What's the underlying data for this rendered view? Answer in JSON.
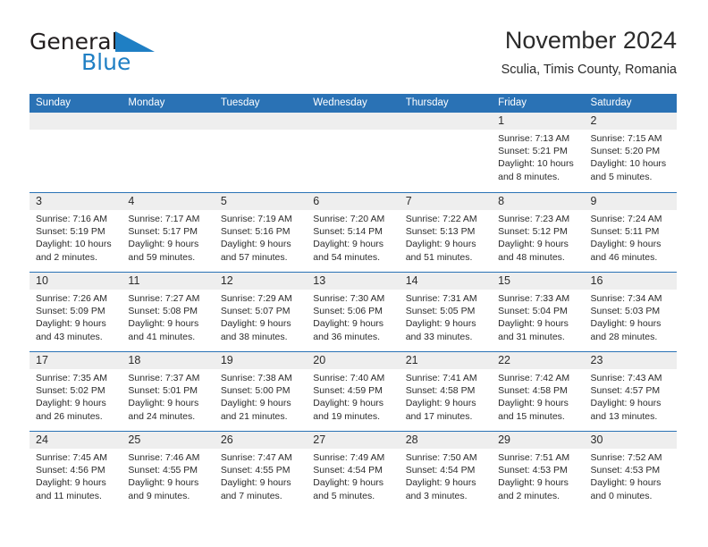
{
  "brand": {
    "name_part1": "General",
    "name_part2": "Blue",
    "accent_color": "#1f7fc4"
  },
  "header": {
    "title": "November 2024",
    "subtitle": "Sculia, Timis County, Romania"
  },
  "theme": {
    "header_blue": "#2a72b5",
    "day_band_gray": "#eeeeee",
    "text_color": "#2b2b2b"
  },
  "weekdays": [
    "Sunday",
    "Monday",
    "Tuesday",
    "Wednesday",
    "Thursday",
    "Friday",
    "Saturday"
  ],
  "weeks": [
    [
      {
        "day": "",
        "sunrise": "",
        "sunset": "",
        "daylight": "",
        "empty": true
      },
      {
        "day": "",
        "sunrise": "",
        "sunset": "",
        "daylight": "",
        "empty": true
      },
      {
        "day": "",
        "sunrise": "",
        "sunset": "",
        "daylight": "",
        "empty": true
      },
      {
        "day": "",
        "sunrise": "",
        "sunset": "",
        "daylight": "",
        "empty": true
      },
      {
        "day": "",
        "sunrise": "",
        "sunset": "",
        "daylight": "",
        "empty": true
      },
      {
        "day": "1",
        "sunrise": "Sunrise: 7:13 AM",
        "sunset": "Sunset: 5:21 PM",
        "daylight": "Daylight: 10 hours and 8 minutes."
      },
      {
        "day": "2",
        "sunrise": "Sunrise: 7:15 AM",
        "sunset": "Sunset: 5:20 PM",
        "daylight": "Daylight: 10 hours and 5 minutes."
      }
    ],
    [
      {
        "day": "3",
        "sunrise": "Sunrise: 7:16 AM",
        "sunset": "Sunset: 5:19 PM",
        "daylight": "Daylight: 10 hours and 2 minutes."
      },
      {
        "day": "4",
        "sunrise": "Sunrise: 7:17 AM",
        "sunset": "Sunset: 5:17 PM",
        "daylight": "Daylight: 9 hours and 59 minutes."
      },
      {
        "day": "5",
        "sunrise": "Sunrise: 7:19 AM",
        "sunset": "Sunset: 5:16 PM",
        "daylight": "Daylight: 9 hours and 57 minutes."
      },
      {
        "day": "6",
        "sunrise": "Sunrise: 7:20 AM",
        "sunset": "Sunset: 5:14 PM",
        "daylight": "Daylight: 9 hours and 54 minutes."
      },
      {
        "day": "7",
        "sunrise": "Sunrise: 7:22 AM",
        "sunset": "Sunset: 5:13 PM",
        "daylight": "Daylight: 9 hours and 51 minutes."
      },
      {
        "day": "8",
        "sunrise": "Sunrise: 7:23 AM",
        "sunset": "Sunset: 5:12 PM",
        "daylight": "Daylight: 9 hours and 48 minutes."
      },
      {
        "day": "9",
        "sunrise": "Sunrise: 7:24 AM",
        "sunset": "Sunset: 5:11 PM",
        "daylight": "Daylight: 9 hours and 46 minutes."
      }
    ],
    [
      {
        "day": "10",
        "sunrise": "Sunrise: 7:26 AM",
        "sunset": "Sunset: 5:09 PM",
        "daylight": "Daylight: 9 hours and 43 minutes."
      },
      {
        "day": "11",
        "sunrise": "Sunrise: 7:27 AM",
        "sunset": "Sunset: 5:08 PM",
        "daylight": "Daylight: 9 hours and 41 minutes."
      },
      {
        "day": "12",
        "sunrise": "Sunrise: 7:29 AM",
        "sunset": "Sunset: 5:07 PM",
        "daylight": "Daylight: 9 hours and 38 minutes."
      },
      {
        "day": "13",
        "sunrise": "Sunrise: 7:30 AM",
        "sunset": "Sunset: 5:06 PM",
        "daylight": "Daylight: 9 hours and 36 minutes."
      },
      {
        "day": "14",
        "sunrise": "Sunrise: 7:31 AM",
        "sunset": "Sunset: 5:05 PM",
        "daylight": "Daylight: 9 hours and 33 minutes."
      },
      {
        "day": "15",
        "sunrise": "Sunrise: 7:33 AM",
        "sunset": "Sunset: 5:04 PM",
        "daylight": "Daylight: 9 hours and 31 minutes."
      },
      {
        "day": "16",
        "sunrise": "Sunrise: 7:34 AM",
        "sunset": "Sunset: 5:03 PM",
        "daylight": "Daylight: 9 hours and 28 minutes."
      }
    ],
    [
      {
        "day": "17",
        "sunrise": "Sunrise: 7:35 AM",
        "sunset": "Sunset: 5:02 PM",
        "daylight": "Daylight: 9 hours and 26 minutes."
      },
      {
        "day": "18",
        "sunrise": "Sunrise: 7:37 AM",
        "sunset": "Sunset: 5:01 PM",
        "daylight": "Daylight: 9 hours and 24 minutes."
      },
      {
        "day": "19",
        "sunrise": "Sunrise: 7:38 AM",
        "sunset": "Sunset: 5:00 PM",
        "daylight": "Daylight: 9 hours and 21 minutes."
      },
      {
        "day": "20",
        "sunrise": "Sunrise: 7:40 AM",
        "sunset": "Sunset: 4:59 PM",
        "daylight": "Daylight: 9 hours and 19 minutes."
      },
      {
        "day": "21",
        "sunrise": "Sunrise: 7:41 AM",
        "sunset": "Sunset: 4:58 PM",
        "daylight": "Daylight: 9 hours and 17 minutes."
      },
      {
        "day": "22",
        "sunrise": "Sunrise: 7:42 AM",
        "sunset": "Sunset: 4:58 PM",
        "daylight": "Daylight: 9 hours and 15 minutes."
      },
      {
        "day": "23",
        "sunrise": "Sunrise: 7:43 AM",
        "sunset": "Sunset: 4:57 PM",
        "daylight": "Daylight: 9 hours and 13 minutes."
      }
    ],
    [
      {
        "day": "24",
        "sunrise": "Sunrise: 7:45 AM",
        "sunset": "Sunset: 4:56 PM",
        "daylight": "Daylight: 9 hours and 11 minutes."
      },
      {
        "day": "25",
        "sunrise": "Sunrise: 7:46 AM",
        "sunset": "Sunset: 4:55 PM",
        "daylight": "Daylight: 9 hours and 9 minutes."
      },
      {
        "day": "26",
        "sunrise": "Sunrise: 7:47 AM",
        "sunset": "Sunset: 4:55 PM",
        "daylight": "Daylight: 9 hours and 7 minutes."
      },
      {
        "day": "27",
        "sunrise": "Sunrise: 7:49 AM",
        "sunset": "Sunset: 4:54 PM",
        "daylight": "Daylight: 9 hours and 5 minutes."
      },
      {
        "day": "28",
        "sunrise": "Sunrise: 7:50 AM",
        "sunset": "Sunset: 4:54 PM",
        "daylight": "Daylight: 9 hours and 3 minutes."
      },
      {
        "day": "29",
        "sunrise": "Sunrise: 7:51 AM",
        "sunset": "Sunset: 4:53 PM",
        "daylight": "Daylight: 9 hours and 2 minutes."
      },
      {
        "day": "30",
        "sunrise": "Sunrise: 7:52 AM",
        "sunset": "Sunset: 4:53 PM",
        "daylight": "Daylight: 9 hours and 0 minutes."
      }
    ]
  ]
}
